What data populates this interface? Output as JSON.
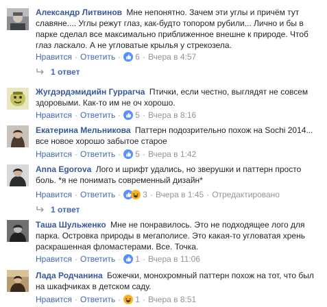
{
  "comments": [
    {
      "author": "Александр Литвинов",
      "text": "Мне непонятно. Зачем эти углы и причём тут славяне.... Углы режут глаз, как-будто топором рубили... Лично и бы в парке сделал все максимально приближенное внешне к природе. Чтоб глаз ласкало. А не угловатые крылья у стрекозела.",
      "like_label": "Нравится",
      "reply_label": "Ответить",
      "reactions_count": "6",
      "time": "Вчера в 4:57",
      "replies_label": "1 ответ"
    },
    {
      "author": "Жугдэрдэмидийн Гуррагча",
      "text": "Птички, если честно, выглядят не совсем здоровыми. Как-то им не оч хорошо.",
      "like_label": "Нравится",
      "reply_label": "Ответить",
      "reactions_count": "5",
      "time": "Вчера в 8:16"
    },
    {
      "author": "Екатерина Мельникова",
      "text": "Паттерн подозрительно похож на Sochi 2014... все новое хорошо забытое старое",
      "like_label": "Нравится",
      "reply_label": "Ответить",
      "reactions_count": "5",
      "time": "Вчера в 1:42"
    },
    {
      "author": "Anna Egorova",
      "text": "Лого и шрифт удались, но зверушки и паттерн просто боль. *я не понимать современный дизайн*",
      "like_label": "Нравится",
      "reply_label": "Ответить",
      "reactions_count": "3",
      "time": "Вчера в 1:45",
      "edited_label": "Отредактировано",
      "replies_label": "1 ответ"
    },
    {
      "author": "Таша Шульженко",
      "text": "Мне не понравилось. Это не подходящее лого для парка. Островка природы в мегаполисе. Это какая-то угловатая хрень раскрашенная фломастерами. Все. Точка.",
      "like_label": "Нравится",
      "reply_label": "Ответить",
      "reactions_count": "1",
      "time": "Вчера в 11:06"
    },
    {
      "author": "Лада Родчанина",
      "text": "Божечки, монохромный паттерн похож на тот, что был на шкафчиках в детском саду.",
      "like_label": "Нравится",
      "reply_label": "Ответить",
      "reactions_count": "1",
      "time": "Вчера в 8:51"
    }
  ],
  "colors": {
    "link": "#4267b2",
    "author": "#365899",
    "text": "#1d2129",
    "meta": "#90949c",
    "like_reaction": "#5890ff",
    "haha_reaction": "#f7b125"
  },
  "icons": {
    "like": "thumbs-up-reaction-icon",
    "haha": "laughing-face-reaction-icon",
    "reply_arrow": "reply-arrow-icon"
  }
}
